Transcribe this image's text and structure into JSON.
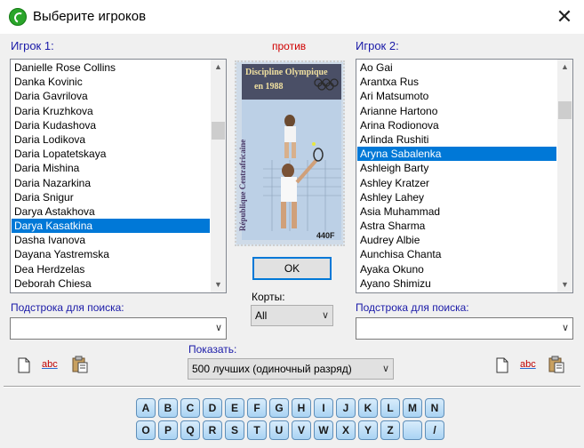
{
  "window": {
    "title": "Выберите игроков",
    "close": "✕"
  },
  "player1": {
    "label": "Игрок 1:",
    "items": [
      "Danielle Rose Collins",
      "Danka Kovinic",
      "Daria Gavrilova",
      "Daria Kruzhkova",
      "Daria Kudashova",
      "Daria Lodikova",
      "Daria Lopatetskaya",
      "Daria Mishina",
      "Daria Nazarkina",
      "Daria Snigur",
      "Darya Astakhova",
      "Darya Kasatkina",
      "Dasha Ivanova",
      "Dayana Yastremska",
      "Dea Herdzelas",
      "Deborah Chiesa"
    ],
    "selected": "Darya Kasatkina",
    "search_label": "Подстрока для поиска:",
    "search_value": ""
  },
  "player2": {
    "label": "Игрок 2:",
    "items": [
      "Ao Gai",
      "Arantxa Rus",
      "Ari Matsumoto",
      "Arianne Hartono",
      "Arina Rodionova",
      "Arlinda Rushiti",
      "Aryna Sabalenka",
      "Ashleigh Barty",
      "Ashley Kratzer",
      "Ashley Lahey",
      "Asia Muhammad",
      "Astra Sharma",
      "Audrey Albie",
      "Aunchisa Chanta",
      "Ayaka Okuno",
      "Ayano Shimizu"
    ],
    "selected": "Aryna Sabalenka",
    "search_label": "Подстрока для поиска:",
    "search_value": ""
  },
  "versus": "против",
  "stamp": {
    "line1": "Discipline Olympique",
    "line2": "en 1988",
    "country": "République Centrafricaine",
    "value": "440F"
  },
  "ok_label": "OK",
  "courts": {
    "label": "Корты:",
    "value": "All"
  },
  "show": {
    "label": "Показать:",
    "value": "500 лучших (одиночный разряд)"
  },
  "toolbar": {
    "abc": "abc"
  },
  "keyboard": {
    "row1": [
      "A",
      "B",
      "C",
      "D",
      "E",
      "F",
      "G",
      "H",
      "I",
      "J",
      "K",
      "L",
      "M",
      "N"
    ],
    "row2": [
      "O",
      "P",
      "Q",
      "R",
      "S",
      "T",
      "U",
      "V",
      "W",
      "X",
      "Y",
      "Z",
      "",
      "/"
    ]
  },
  "icons": {
    "new": "page-icon",
    "spell": "abc-icon",
    "paste": "clipboard-icon",
    "dropdown": "chevron-down-icon",
    "up": "scroll-up-icon",
    "down": "scroll-down-icon"
  }
}
